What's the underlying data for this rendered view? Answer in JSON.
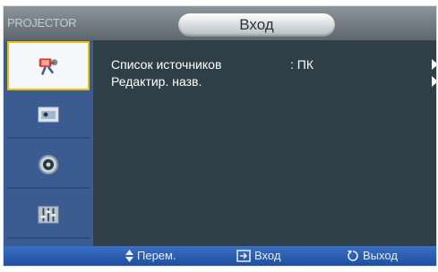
{
  "header": {
    "brand": "PROJECTOR",
    "title": "Вход"
  },
  "sidebar": {
    "items": [
      {
        "icon": "input-plug-icon",
        "active": true
      },
      {
        "icon": "picture-icon",
        "active": false
      },
      {
        "icon": "setup-gear-icon",
        "active": false
      },
      {
        "icon": "equalizer-icon",
        "active": false
      }
    ]
  },
  "menu": {
    "rows": [
      {
        "label": "Список источников",
        "value": ": ПК"
      },
      {
        "label": "Редактир. назв.",
        "value": ""
      }
    ]
  },
  "footer": {
    "move": "Перем.",
    "enter": "Вход",
    "exit": "Выход"
  },
  "colors": {
    "sidebar": "#3b5c90",
    "content": "#2f3f47",
    "footer": "#1f4f9e",
    "highlight": "#f0c000"
  }
}
